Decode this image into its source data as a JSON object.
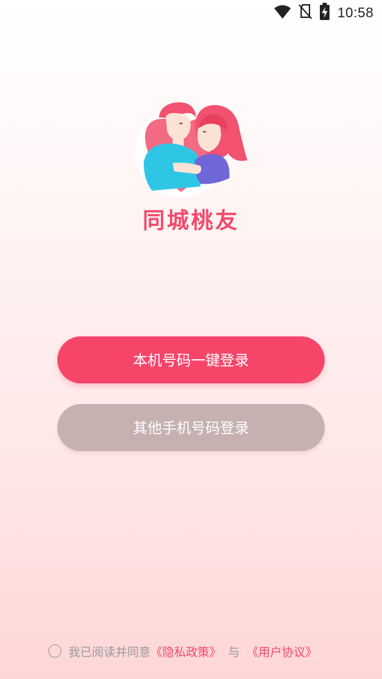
{
  "status_bar": {
    "time": "10:58",
    "icons": [
      "wifi-icon",
      "no-sim-icon",
      "battery-charging-icon"
    ]
  },
  "app": {
    "name": "同城桃友",
    "logo_icon": "couple-logo-icon"
  },
  "buttons": {
    "one_click_login": "本机号码一键登录",
    "other_phone_login": "其他手机号码登录"
  },
  "agreement": {
    "checked": false,
    "prefix": "我已阅读并同意",
    "privacy_policy": "《隐私政策》",
    "and": "与",
    "user_agreement": "《用户协议》"
  },
  "colors": {
    "primary": "#f7456a",
    "secondary": "#c6b0b0",
    "link": "#f24a6d",
    "app_name": "#f24a6d"
  }
}
